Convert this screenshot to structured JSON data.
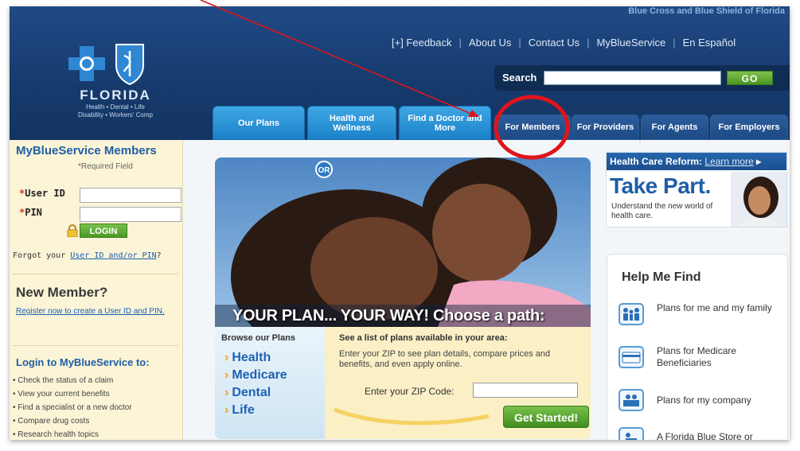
{
  "header": {
    "brandline": "Blue Cross and Blue Shield of Florida",
    "logo": {
      "state": "FLORIDA",
      "sub1": "Health • Dental • Life",
      "sub2": "Disability • Workers' Comp"
    },
    "util_nav": [
      "[+] Feedback",
      "About Us",
      "Contact Us",
      "MyBlueService",
      "En Español"
    ],
    "search": {
      "label": "Search",
      "value": "",
      "go": "GO"
    },
    "tabs": [
      {
        "label": "Our Plans"
      },
      {
        "label": "Health and Wellness"
      },
      {
        "label": "Find a Doctor and More"
      },
      {
        "label": "For Members"
      },
      {
        "label": "For Providers"
      },
      {
        "label": "For Agents"
      },
      {
        "label": "For Employers"
      }
    ]
  },
  "sidebar": {
    "title": "MyBlueService Members",
    "required": "Required Field",
    "user_id_label": "User ID",
    "pin_label": "PIN",
    "login": "LOGIN",
    "forgot_prefix": "Forgot your ",
    "forgot_link": "User ID and/or PIN",
    "forgot_suffix": "?",
    "new_member": "New Member?",
    "register": "Register now to create a User ID and PIN.",
    "login_to": "Login to MyBlueService to:",
    "benefits": [
      "• Check the status of a claim",
      "• View your current benefits",
      "• Find a specialist or a new doctor",
      "• Compare drug costs",
      "• Research health topics"
    ]
  },
  "hero": {
    "headline": "YOUR PLAN... YOUR WAY!  Choose a path:",
    "browse_title": "Browse our Plans",
    "or": "OR",
    "plans": [
      "Health",
      "Medicare",
      "Dental",
      "Life"
    ],
    "zip_title": "See a list of plans available in your area:",
    "zip_desc": "Enter your ZIP to see plan details, compare prices and benefits, and even apply online.",
    "zip_label": "Enter your ZIP Code:",
    "zip_value": "",
    "get_started": "Get Started!"
  },
  "right": {
    "hcr_title": "Health Care Reform:",
    "hcr_link": "Learn more",
    "take_part": "Take Part.",
    "take_sub": "Understand the new world of health care.",
    "help_title": "Help Me Find",
    "help_items": [
      {
        "icon": "family-icon",
        "text": "Plans for me and my family"
      },
      {
        "icon": "medicare-card-icon",
        "text": "Plans for Medicare Beneficiaries"
      },
      {
        "icon": "company-icon",
        "text": "Plans for my company"
      },
      {
        "icon": "store-icon",
        "text": "A Florida Blue Store or"
      }
    ]
  },
  "colors": {
    "header_blue": "#163a6c",
    "tab_blue": "#1b82c9",
    "link_blue": "#1a5fb4",
    "green": "#4a9a26",
    "annotation_red": "#e0141b"
  }
}
